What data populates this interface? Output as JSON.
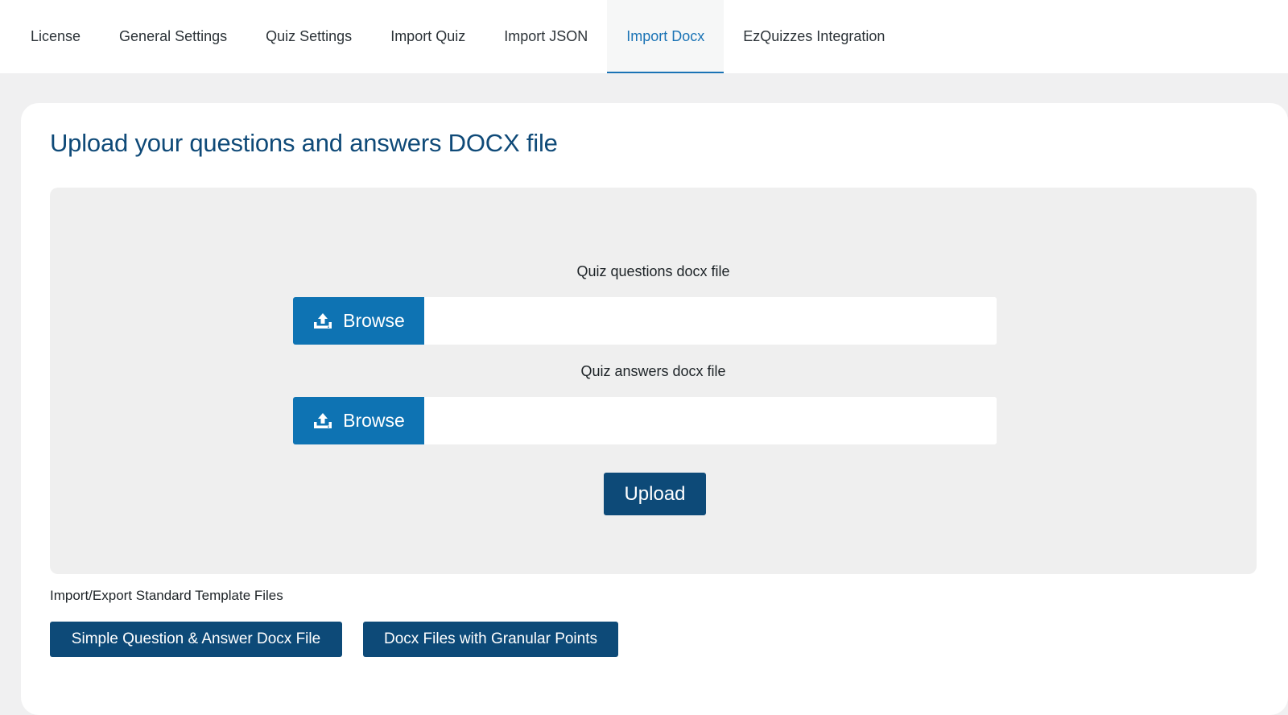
{
  "tabs": [
    {
      "label": "License",
      "active": false
    },
    {
      "label": "General Settings",
      "active": false
    },
    {
      "label": "Quiz Settings",
      "active": false
    },
    {
      "label": "Import Quiz",
      "active": false
    },
    {
      "label": "Import JSON",
      "active": false
    },
    {
      "label": "Import Docx",
      "active": true
    },
    {
      "label": "EzQuizzes Integration",
      "active": false
    }
  ],
  "main": {
    "title": "Upload your questions and answers DOCX file",
    "questions_field": {
      "label": "Quiz questions docx file",
      "browse_label": "Browse",
      "value": ""
    },
    "answers_field": {
      "label": "Quiz answers docx file",
      "browse_label": "Browse",
      "value": ""
    },
    "upload_label": "Upload",
    "templates": {
      "label": "Import/Export Standard Template Files",
      "simple_label": "Simple Question & Answer Docx File",
      "granular_label": "Docx Files with Granular Points"
    }
  },
  "colors": {
    "accent": "#1a73b5",
    "browse_bg": "#0e73b3",
    "primary_button": "#0d4a78",
    "title": "#0f4a78",
    "panel_bg": "#efefef",
    "page_bg": "#f0f0f1"
  },
  "icons": {
    "browse": "upload-icon"
  }
}
